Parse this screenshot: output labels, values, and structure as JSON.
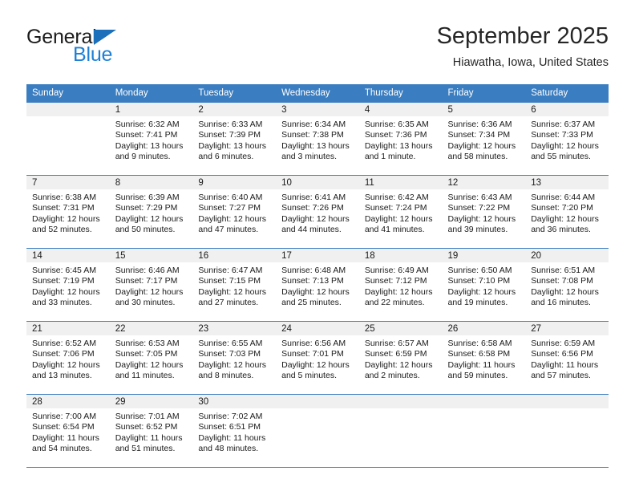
{
  "brand": {
    "name_part1": "General",
    "name_part2": "Blue",
    "triangle_icon": "triangle-icon",
    "colors": {
      "black": "#1b1b1b",
      "blue": "#1c7fd6",
      "triangle": "#1c6fba"
    }
  },
  "header": {
    "title": "September 2025",
    "subtitle": "Hiawatha, Iowa, United States"
  },
  "theme": {
    "header_bg": "#3a7dc0",
    "daynum_bg": "#f0f0f0",
    "row_divider": "#3a7dc0",
    "text": "#1a1a1a"
  },
  "columns": [
    {
      "label": "Sunday"
    },
    {
      "label": "Monday"
    },
    {
      "label": "Tuesday"
    },
    {
      "label": "Wednesday"
    },
    {
      "label": "Thursday"
    },
    {
      "label": "Friday"
    },
    {
      "label": "Saturday"
    }
  ],
  "weeks": [
    [
      {
        "day": "",
        "sunrise": "",
        "sunset": "",
        "daylight1": "",
        "daylight2": "",
        "empty": true
      },
      {
        "day": "1",
        "sunrise": "Sunrise: 6:32 AM",
        "sunset": "Sunset: 7:41 PM",
        "daylight1": "Daylight: 13 hours",
        "daylight2": "and 9 minutes."
      },
      {
        "day": "2",
        "sunrise": "Sunrise: 6:33 AM",
        "sunset": "Sunset: 7:39 PM",
        "daylight1": "Daylight: 13 hours",
        "daylight2": "and 6 minutes."
      },
      {
        "day": "3",
        "sunrise": "Sunrise: 6:34 AM",
        "sunset": "Sunset: 7:38 PM",
        "daylight1": "Daylight: 13 hours",
        "daylight2": "and 3 minutes."
      },
      {
        "day": "4",
        "sunrise": "Sunrise: 6:35 AM",
        "sunset": "Sunset: 7:36 PM",
        "daylight1": "Daylight: 13 hours",
        "daylight2": "and 1 minute."
      },
      {
        "day": "5",
        "sunrise": "Sunrise: 6:36 AM",
        "sunset": "Sunset: 7:34 PM",
        "daylight1": "Daylight: 12 hours",
        "daylight2": "and 58 minutes."
      },
      {
        "day": "6",
        "sunrise": "Sunrise: 6:37 AM",
        "sunset": "Sunset: 7:33 PM",
        "daylight1": "Daylight: 12 hours",
        "daylight2": "and 55 minutes."
      }
    ],
    [
      {
        "day": "7",
        "sunrise": "Sunrise: 6:38 AM",
        "sunset": "Sunset: 7:31 PM",
        "daylight1": "Daylight: 12 hours",
        "daylight2": "and 52 minutes."
      },
      {
        "day": "8",
        "sunrise": "Sunrise: 6:39 AM",
        "sunset": "Sunset: 7:29 PM",
        "daylight1": "Daylight: 12 hours",
        "daylight2": "and 50 minutes."
      },
      {
        "day": "9",
        "sunrise": "Sunrise: 6:40 AM",
        "sunset": "Sunset: 7:27 PM",
        "daylight1": "Daylight: 12 hours",
        "daylight2": "and 47 minutes."
      },
      {
        "day": "10",
        "sunrise": "Sunrise: 6:41 AM",
        "sunset": "Sunset: 7:26 PM",
        "daylight1": "Daylight: 12 hours",
        "daylight2": "and 44 minutes."
      },
      {
        "day": "11",
        "sunrise": "Sunrise: 6:42 AM",
        "sunset": "Sunset: 7:24 PM",
        "daylight1": "Daylight: 12 hours",
        "daylight2": "and 41 minutes."
      },
      {
        "day": "12",
        "sunrise": "Sunrise: 6:43 AM",
        "sunset": "Sunset: 7:22 PM",
        "daylight1": "Daylight: 12 hours",
        "daylight2": "and 39 minutes."
      },
      {
        "day": "13",
        "sunrise": "Sunrise: 6:44 AM",
        "sunset": "Sunset: 7:20 PM",
        "daylight1": "Daylight: 12 hours",
        "daylight2": "and 36 minutes."
      }
    ],
    [
      {
        "day": "14",
        "sunrise": "Sunrise: 6:45 AM",
        "sunset": "Sunset: 7:19 PM",
        "daylight1": "Daylight: 12 hours",
        "daylight2": "and 33 minutes."
      },
      {
        "day": "15",
        "sunrise": "Sunrise: 6:46 AM",
        "sunset": "Sunset: 7:17 PM",
        "daylight1": "Daylight: 12 hours",
        "daylight2": "and 30 minutes."
      },
      {
        "day": "16",
        "sunrise": "Sunrise: 6:47 AM",
        "sunset": "Sunset: 7:15 PM",
        "daylight1": "Daylight: 12 hours",
        "daylight2": "and 27 minutes."
      },
      {
        "day": "17",
        "sunrise": "Sunrise: 6:48 AM",
        "sunset": "Sunset: 7:13 PM",
        "daylight1": "Daylight: 12 hours",
        "daylight2": "and 25 minutes."
      },
      {
        "day": "18",
        "sunrise": "Sunrise: 6:49 AM",
        "sunset": "Sunset: 7:12 PM",
        "daylight1": "Daylight: 12 hours",
        "daylight2": "and 22 minutes."
      },
      {
        "day": "19",
        "sunrise": "Sunrise: 6:50 AM",
        "sunset": "Sunset: 7:10 PM",
        "daylight1": "Daylight: 12 hours",
        "daylight2": "and 19 minutes."
      },
      {
        "day": "20",
        "sunrise": "Sunrise: 6:51 AM",
        "sunset": "Sunset: 7:08 PM",
        "daylight1": "Daylight: 12 hours",
        "daylight2": "and 16 minutes."
      }
    ],
    [
      {
        "day": "21",
        "sunrise": "Sunrise: 6:52 AM",
        "sunset": "Sunset: 7:06 PM",
        "daylight1": "Daylight: 12 hours",
        "daylight2": "and 13 minutes."
      },
      {
        "day": "22",
        "sunrise": "Sunrise: 6:53 AM",
        "sunset": "Sunset: 7:05 PM",
        "daylight1": "Daylight: 12 hours",
        "daylight2": "and 11 minutes."
      },
      {
        "day": "23",
        "sunrise": "Sunrise: 6:55 AM",
        "sunset": "Sunset: 7:03 PM",
        "daylight1": "Daylight: 12 hours",
        "daylight2": "and 8 minutes."
      },
      {
        "day": "24",
        "sunrise": "Sunrise: 6:56 AM",
        "sunset": "Sunset: 7:01 PM",
        "daylight1": "Daylight: 12 hours",
        "daylight2": "and 5 minutes."
      },
      {
        "day": "25",
        "sunrise": "Sunrise: 6:57 AM",
        "sunset": "Sunset: 6:59 PM",
        "daylight1": "Daylight: 12 hours",
        "daylight2": "and 2 minutes."
      },
      {
        "day": "26",
        "sunrise": "Sunrise: 6:58 AM",
        "sunset": "Sunset: 6:58 PM",
        "daylight1": "Daylight: 11 hours",
        "daylight2": "and 59 minutes."
      },
      {
        "day": "27",
        "sunrise": "Sunrise: 6:59 AM",
        "sunset": "Sunset: 6:56 PM",
        "daylight1": "Daylight: 11 hours",
        "daylight2": "and 57 minutes."
      }
    ],
    [
      {
        "day": "28",
        "sunrise": "Sunrise: 7:00 AM",
        "sunset": "Sunset: 6:54 PM",
        "daylight1": "Daylight: 11 hours",
        "daylight2": "and 54 minutes."
      },
      {
        "day": "29",
        "sunrise": "Sunrise: 7:01 AM",
        "sunset": "Sunset: 6:52 PM",
        "daylight1": "Daylight: 11 hours",
        "daylight2": "and 51 minutes."
      },
      {
        "day": "30",
        "sunrise": "Sunrise: 7:02 AM",
        "sunset": "Sunset: 6:51 PM",
        "daylight1": "Daylight: 11 hours",
        "daylight2": "and 48 minutes."
      },
      {
        "day": "",
        "sunrise": "",
        "sunset": "",
        "daylight1": "",
        "daylight2": "",
        "empty": true
      },
      {
        "day": "",
        "sunrise": "",
        "sunset": "",
        "daylight1": "",
        "daylight2": "",
        "empty": true
      },
      {
        "day": "",
        "sunrise": "",
        "sunset": "",
        "daylight1": "",
        "daylight2": "",
        "empty": true
      },
      {
        "day": "",
        "sunrise": "",
        "sunset": "",
        "daylight1": "",
        "daylight2": "",
        "empty": true
      }
    ]
  ]
}
